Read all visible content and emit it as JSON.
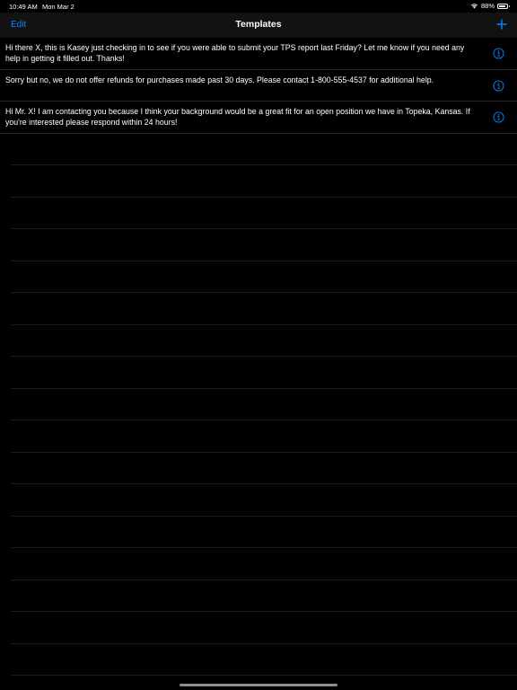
{
  "status_bar": {
    "time": "10:49 AM",
    "date": "Mon Mar 2",
    "battery": "88%",
    "battery_level": 0.88
  },
  "nav": {
    "edit_label": "Edit",
    "title": "Templates"
  },
  "templates": [
    "Hi there X, this is Kasey just checking in to see if you were able to submit your TPS report last Friday? Let me know if you need any help in getting it filled out. Thanks!",
    "Sorry but no, we do not offer refunds for purchases made past 30 days. Please contact 1-800-555-4537 for additional help.",
    "Hi Mr. X! I am contacting you because I think your background would be a great fit for an open position we have in Topeka, Kansas. If you're interested please respond within 24 hours!"
  ],
  "colors": {
    "accent": "#0a84ff",
    "background": "#000000",
    "nav_background": "#121212"
  }
}
